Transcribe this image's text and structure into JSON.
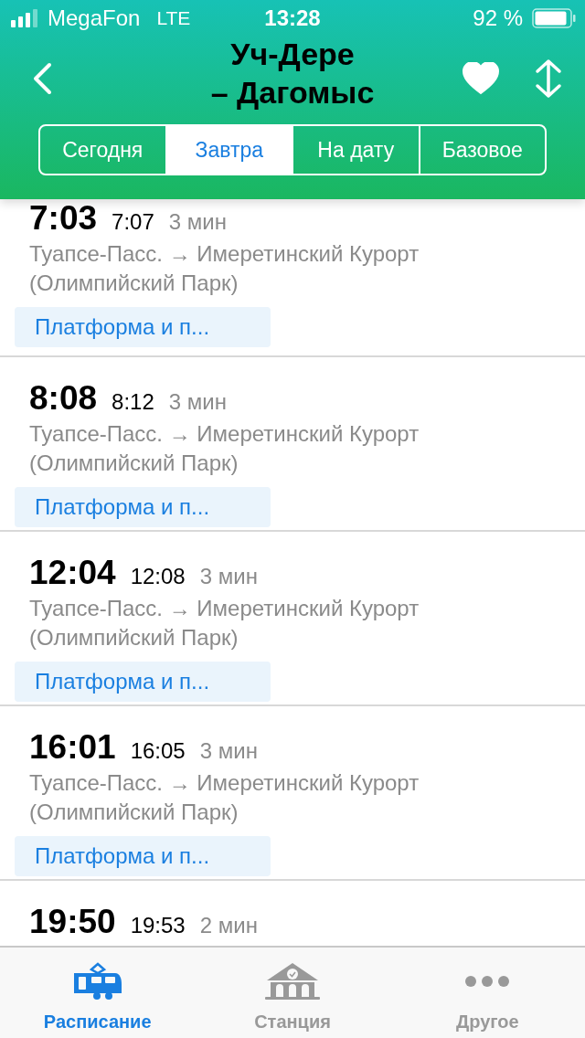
{
  "status_bar": {
    "carrier": "MegaFon",
    "network": "LTE",
    "time": "13:28",
    "battery_text": "92 %"
  },
  "header": {
    "title_line_1": "Уч-Дере",
    "title_line_2": "– Дагомыс",
    "favorite": true
  },
  "tabs": [
    {
      "label": "Сегодня",
      "selected": false
    },
    {
      "label": "Завтра",
      "selected": true
    },
    {
      "label": "На дату",
      "selected": false
    },
    {
      "label": "Базовое",
      "selected": false
    }
  ],
  "trips": [
    {
      "departure": "7:03",
      "arrival": "7:07",
      "duration": "3 мин",
      "route": "Туапсе-Пасс. → Имеретинский Курорт (Олимпийский Парк)",
      "button": "Платформа и п..."
    },
    {
      "departure": "8:08",
      "arrival": "8:12",
      "duration": "3 мин",
      "route": "Туапсе-Пасс. → Имеретинский Курорт (Олимпийский Парк)",
      "button": "Платформа и п..."
    },
    {
      "departure": "12:04",
      "arrival": "12:08",
      "duration": "3 мин",
      "route": "Туапсе-Пасс. → Имеретинский Курорт (Олимпийский Парк)",
      "button": "Платформа и п..."
    },
    {
      "departure": "16:01",
      "arrival": "16:05",
      "duration": "3 мин",
      "route": "Туапсе-Пасс. → Имеретинский Курорт (Олимпийский Парк)",
      "button": "Платформа и п..."
    },
    {
      "departure": "19:50",
      "arrival": "19:53",
      "duration": "2 мин"
    }
  ],
  "tab_bar": [
    {
      "label": "Расписание",
      "kind": "train",
      "selected": true
    },
    {
      "label": "Станция",
      "kind": "station",
      "selected": false
    },
    {
      "label": "Другое",
      "kind": "more",
      "selected": false
    }
  ]
}
